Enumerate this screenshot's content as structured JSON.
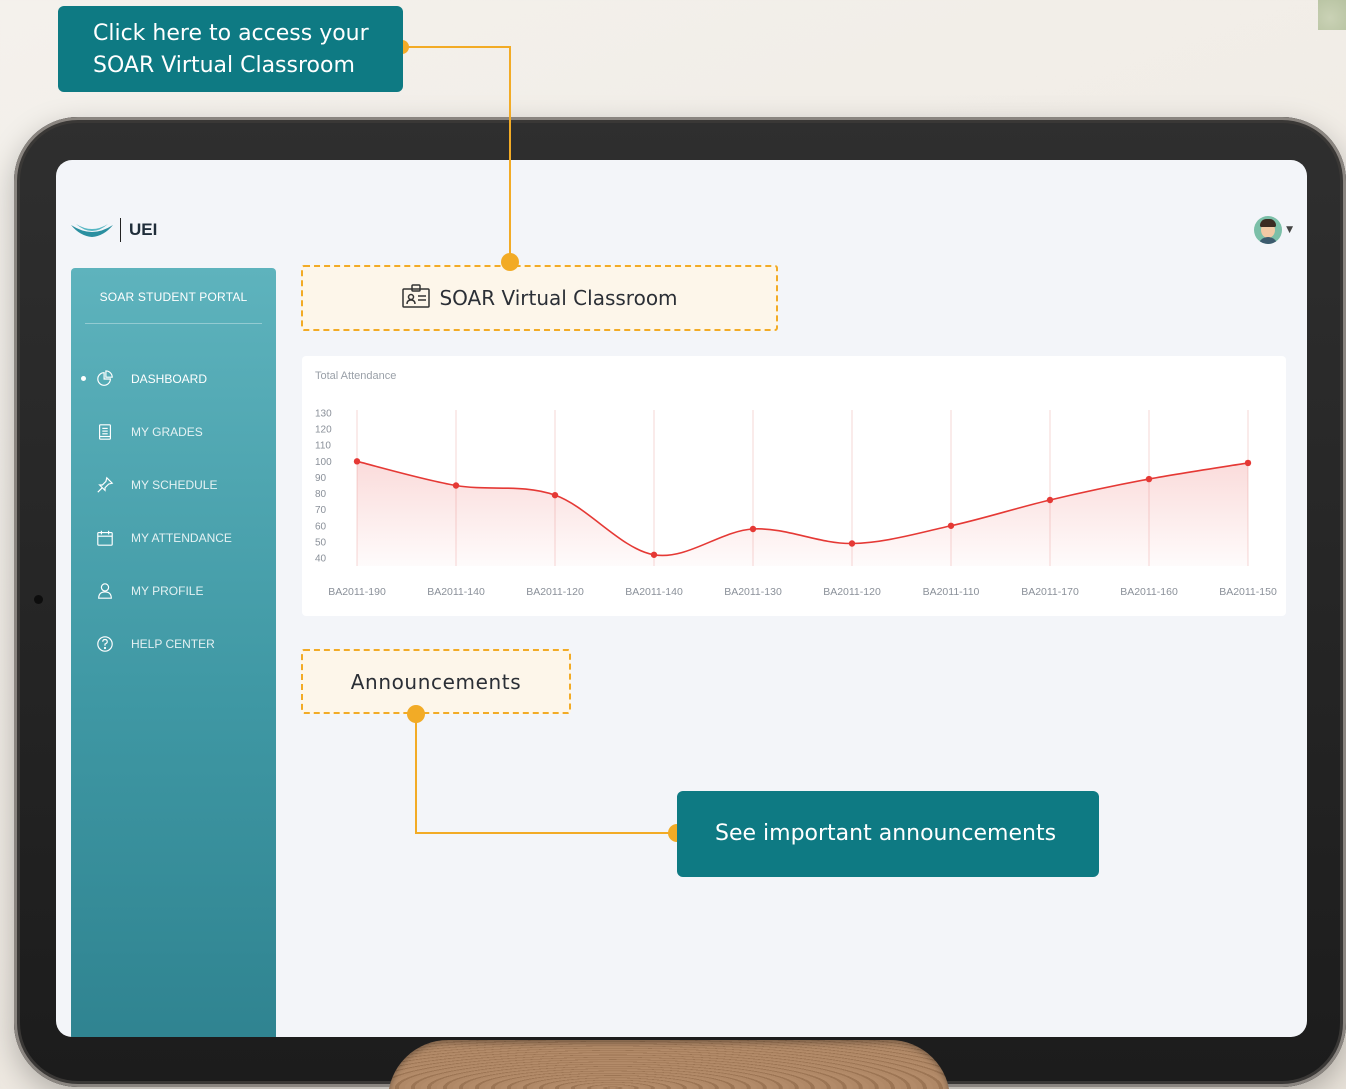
{
  "header": {
    "logo_text": "UEI"
  },
  "sidebar": {
    "title": "SOAR STUDENT PORTAL",
    "items": [
      {
        "label": "DASHBOARD",
        "icon": "pie-chart-icon",
        "active": true
      },
      {
        "label": "MY GRADES",
        "icon": "document-list-icon",
        "active": false
      },
      {
        "label": "MY SCHEDULE",
        "icon": "pin-icon",
        "active": false
      },
      {
        "label": "MY ATTENDANCE",
        "icon": "calendar-icon",
        "active": false
      },
      {
        "label": "MY PROFILE",
        "icon": "user-icon",
        "active": false
      },
      {
        "label": "HELP CENTER",
        "icon": "help-circle-icon",
        "active": false
      }
    ]
  },
  "main": {
    "virtual_classroom_label": "SOAR Virtual Classroom",
    "announcements_label": "Announcements"
  },
  "callouts": {
    "top": [
      "Click here to access your",
      "SOAR Virtual Classroom"
    ],
    "bottom": "See important announcements"
  },
  "colors": {
    "accent": "#0e7a83",
    "highlight": "#f2ab26",
    "line": "#e53935",
    "sidebar": "#4fa6b1"
  },
  "chart_data": {
    "type": "line",
    "title": "Total Attendance",
    "categories": [
      "BA2011-190",
      "BA2011-140",
      "BA2011-120",
      "BA2011-140",
      "BA2011-130",
      "BA2011-120",
      "BA2011-110",
      "BA2011-170",
      "BA2011-160",
      "BA2011-150"
    ],
    "values": [
      100,
      85,
      79,
      42,
      58,
      49,
      60,
      76,
      89,
      99
    ],
    "yticks": [
      130,
      120,
      110,
      100,
      90,
      80,
      70,
      60,
      50,
      40
    ],
    "ylim": [
      40,
      130
    ],
    "grid": "vertical"
  }
}
